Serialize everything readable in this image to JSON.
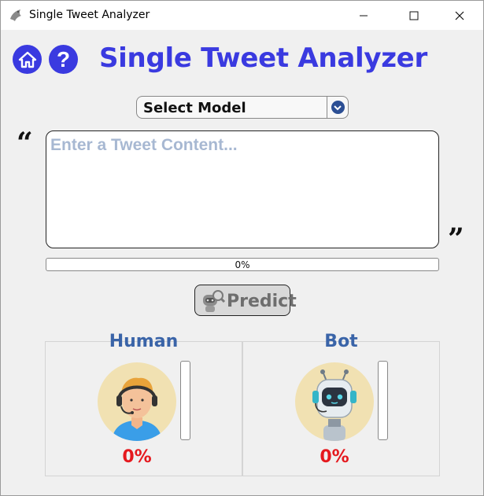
{
  "window": {
    "title": "Single Tweet Analyzer",
    "controls": [
      "minimize-icon",
      "maximize-icon",
      "close-icon"
    ]
  },
  "header": {
    "title": "Single Tweet Analyzer",
    "home_icon": "home-icon",
    "help_label": "?",
    "accent_color": "#3a3ae0"
  },
  "model_select": {
    "label": "Select Model",
    "arrow_icon": "chevron-down-icon"
  },
  "tweet": {
    "open_quote": "“",
    "close_quote": "”",
    "value": "",
    "placeholder": "Enter a Tweet Content..."
  },
  "progress": {
    "value": 0,
    "text": "0%"
  },
  "predict": {
    "label": "Predict",
    "icon": "robot-search-icon"
  },
  "results": {
    "human": {
      "title": "Human",
      "percent_text": "0%",
      "value": 0,
      "avatar": "human-avatar-icon"
    },
    "bot": {
      "title": "Bot",
      "percent_text": "0%",
      "value": 0,
      "avatar": "robot-avatar-icon"
    },
    "percent_color": "#e5191e",
    "title_color": "#3a64a8"
  }
}
